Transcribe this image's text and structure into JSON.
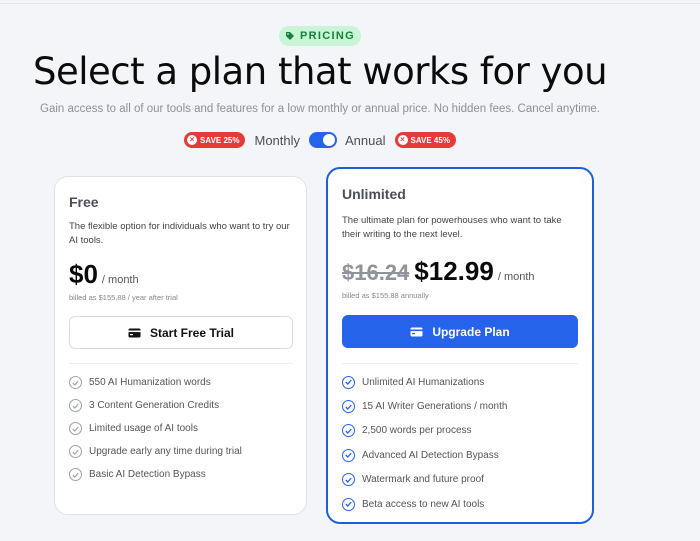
{
  "header": {
    "badge": "PRICING",
    "title": "Select a plan that works for you",
    "subtitle": "Gain access to all of our tools and features for a low monthly or annual price. No hidden fees. Cancel anytime."
  },
  "billing_toggle": {
    "save_monthly": "SAVE 25%",
    "monthly_label": "Monthly",
    "annual_label": "Annual",
    "save_annual": "SAVE 45%",
    "selected": "Annual"
  },
  "plans": [
    {
      "name": "Free",
      "description": "The flexible option for individuals who want to try our AI tools.",
      "price": "$0",
      "per": "/ month",
      "billed": "billed as $155.88 / year after trial",
      "cta": "Start Free Trial",
      "features": [
        "550 AI Humanization words",
        "3 Content Generation Credits",
        "Limited usage of AI tools",
        "Upgrade early any time during trial",
        "Basic AI Detection Bypass"
      ]
    },
    {
      "name": "Unlimited",
      "description": "The ultimate plan for powerhouses who want to take their writing to the next level.",
      "old_price": "$16.24",
      "price": "$12.99",
      "per": "/ month",
      "billed": "billed as $155.88 annually",
      "cta": "Upgrade Plan",
      "features": [
        "Unlimited AI Humanizations",
        "15 AI Writer Generations / month",
        "2,500 words per process",
        "Advanced AI Detection Bypass",
        "Watermark and future proof",
        "Beta access to new AI tools"
      ]
    }
  ],
  "colors": {
    "accent": "#2563eb",
    "badge_bg": "#c8f5d4",
    "badge_text": "#16803c",
    "save_red": "#e53a3a",
    "background": "#f4f5f8"
  },
  "icons": {
    "badge": "tag-icon",
    "save": "close-circle-icon",
    "cta": "credit-card-icon",
    "feature": "check-circle-icon"
  }
}
